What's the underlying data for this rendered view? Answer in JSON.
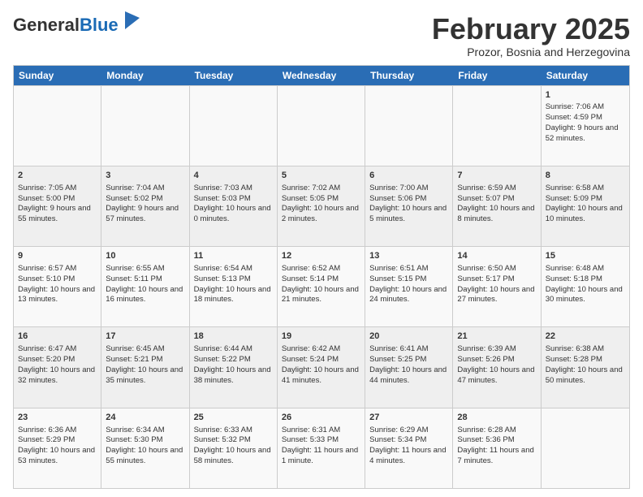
{
  "logo": {
    "general": "General",
    "blue": "Blue"
  },
  "header": {
    "month": "February 2025",
    "location": "Prozor, Bosnia and Herzegovina"
  },
  "weekdays": [
    "Sunday",
    "Monday",
    "Tuesday",
    "Wednesday",
    "Thursday",
    "Friday",
    "Saturday"
  ],
  "weeks": [
    [
      {
        "day": "",
        "info": ""
      },
      {
        "day": "",
        "info": ""
      },
      {
        "day": "",
        "info": ""
      },
      {
        "day": "",
        "info": ""
      },
      {
        "day": "",
        "info": ""
      },
      {
        "day": "",
        "info": ""
      },
      {
        "day": "1",
        "info": "Sunrise: 7:06 AM\nSunset: 4:59 PM\nDaylight: 9 hours and 52 minutes."
      }
    ],
    [
      {
        "day": "2",
        "info": "Sunrise: 7:05 AM\nSunset: 5:00 PM\nDaylight: 9 hours and 55 minutes."
      },
      {
        "day": "3",
        "info": "Sunrise: 7:04 AM\nSunset: 5:02 PM\nDaylight: 9 hours and 57 minutes."
      },
      {
        "day": "4",
        "info": "Sunrise: 7:03 AM\nSunset: 5:03 PM\nDaylight: 10 hours and 0 minutes."
      },
      {
        "day": "5",
        "info": "Sunrise: 7:02 AM\nSunset: 5:05 PM\nDaylight: 10 hours and 2 minutes."
      },
      {
        "day": "6",
        "info": "Sunrise: 7:00 AM\nSunset: 5:06 PM\nDaylight: 10 hours and 5 minutes."
      },
      {
        "day": "7",
        "info": "Sunrise: 6:59 AM\nSunset: 5:07 PM\nDaylight: 10 hours and 8 minutes."
      },
      {
        "day": "8",
        "info": "Sunrise: 6:58 AM\nSunset: 5:09 PM\nDaylight: 10 hours and 10 minutes."
      }
    ],
    [
      {
        "day": "9",
        "info": "Sunrise: 6:57 AM\nSunset: 5:10 PM\nDaylight: 10 hours and 13 minutes."
      },
      {
        "day": "10",
        "info": "Sunrise: 6:55 AM\nSunset: 5:11 PM\nDaylight: 10 hours and 16 minutes."
      },
      {
        "day": "11",
        "info": "Sunrise: 6:54 AM\nSunset: 5:13 PM\nDaylight: 10 hours and 18 minutes."
      },
      {
        "day": "12",
        "info": "Sunrise: 6:52 AM\nSunset: 5:14 PM\nDaylight: 10 hours and 21 minutes."
      },
      {
        "day": "13",
        "info": "Sunrise: 6:51 AM\nSunset: 5:15 PM\nDaylight: 10 hours and 24 minutes."
      },
      {
        "day": "14",
        "info": "Sunrise: 6:50 AM\nSunset: 5:17 PM\nDaylight: 10 hours and 27 minutes."
      },
      {
        "day": "15",
        "info": "Sunrise: 6:48 AM\nSunset: 5:18 PM\nDaylight: 10 hours and 30 minutes."
      }
    ],
    [
      {
        "day": "16",
        "info": "Sunrise: 6:47 AM\nSunset: 5:20 PM\nDaylight: 10 hours and 32 minutes."
      },
      {
        "day": "17",
        "info": "Sunrise: 6:45 AM\nSunset: 5:21 PM\nDaylight: 10 hours and 35 minutes."
      },
      {
        "day": "18",
        "info": "Sunrise: 6:44 AM\nSunset: 5:22 PM\nDaylight: 10 hours and 38 minutes."
      },
      {
        "day": "19",
        "info": "Sunrise: 6:42 AM\nSunset: 5:24 PM\nDaylight: 10 hours and 41 minutes."
      },
      {
        "day": "20",
        "info": "Sunrise: 6:41 AM\nSunset: 5:25 PM\nDaylight: 10 hours and 44 minutes."
      },
      {
        "day": "21",
        "info": "Sunrise: 6:39 AM\nSunset: 5:26 PM\nDaylight: 10 hours and 47 minutes."
      },
      {
        "day": "22",
        "info": "Sunrise: 6:38 AM\nSunset: 5:28 PM\nDaylight: 10 hours and 50 minutes."
      }
    ],
    [
      {
        "day": "23",
        "info": "Sunrise: 6:36 AM\nSunset: 5:29 PM\nDaylight: 10 hours and 53 minutes."
      },
      {
        "day": "24",
        "info": "Sunrise: 6:34 AM\nSunset: 5:30 PM\nDaylight: 10 hours and 55 minutes."
      },
      {
        "day": "25",
        "info": "Sunrise: 6:33 AM\nSunset: 5:32 PM\nDaylight: 10 hours and 58 minutes."
      },
      {
        "day": "26",
        "info": "Sunrise: 6:31 AM\nSunset: 5:33 PM\nDaylight: 11 hours and 1 minute."
      },
      {
        "day": "27",
        "info": "Sunrise: 6:29 AM\nSunset: 5:34 PM\nDaylight: 11 hours and 4 minutes."
      },
      {
        "day": "28",
        "info": "Sunrise: 6:28 AM\nSunset: 5:36 PM\nDaylight: 11 hours and 7 minutes."
      },
      {
        "day": "",
        "info": ""
      }
    ]
  ]
}
